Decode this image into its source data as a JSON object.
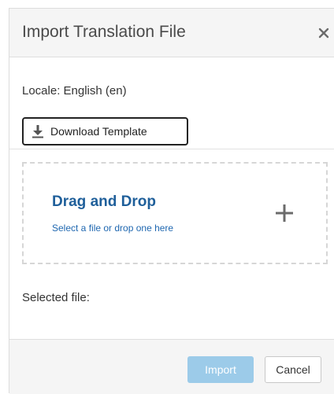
{
  "dialog": {
    "title": "Import Translation File",
    "close_icon": "close-icon"
  },
  "locale": {
    "text": "Locale: English (en)"
  },
  "download": {
    "label": "Download Template",
    "icon": "download-icon"
  },
  "dropzone": {
    "title": "Drag and Drop",
    "subtitle": "Select a file or drop one here",
    "icon": "plus-icon"
  },
  "selected_file": {
    "label": "Selected file:"
  },
  "footer": {
    "import_label": "Import",
    "cancel_label": "Cancel"
  },
  "colors": {
    "link_blue": "#1f5f9a",
    "import_disabled": "#9ccbe9",
    "header_bg": "#f5f5f5"
  }
}
